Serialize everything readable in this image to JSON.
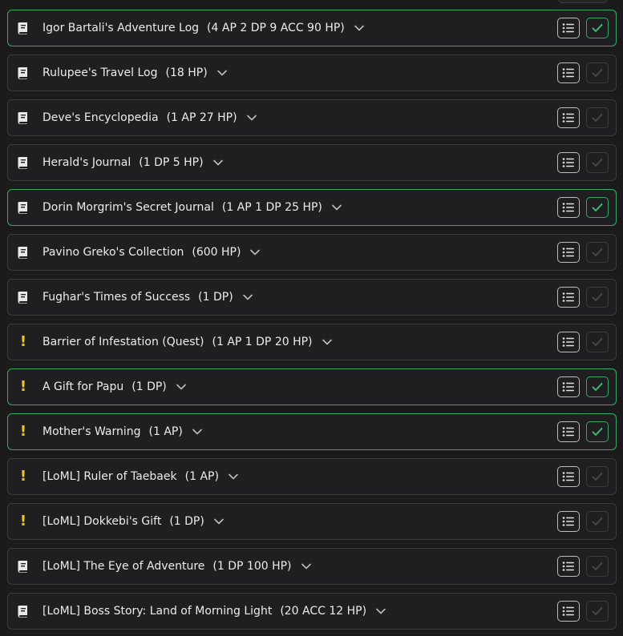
{
  "colors": {
    "background": "#1b1b1c",
    "row_background": "#1f1f21",
    "row_border": "#3a3b3d",
    "completed_accent": "#38a867",
    "quest_icon": "#f0c419",
    "text": "#ececec"
  },
  "quests": [
    {
      "title": "Igor Bartali's Adventure Log",
      "reward": "(4 AP 2 DP 9 ACC 90 HP)",
      "icon": "book-icon",
      "completed": true
    },
    {
      "title": "Rulupee's Travel Log",
      "reward": "(18 HP)",
      "icon": "book-icon",
      "completed": false
    },
    {
      "title": "Deve's Encyclopedia",
      "reward": "(1 AP 27 HP)",
      "icon": "book-icon",
      "completed": false
    },
    {
      "title": "Herald's Journal",
      "reward": "(1 DP 5 HP)",
      "icon": "book-icon",
      "completed": false
    },
    {
      "title": "Dorin Morgrim's Secret Journal",
      "reward": "(1 AP 1 DP 25 HP)",
      "icon": "book-icon",
      "completed": true
    },
    {
      "title": "Pavino Greko's Collection",
      "reward": "(600 HP)",
      "icon": "book-icon",
      "completed": false
    },
    {
      "title": "Fughar's Times of Success",
      "reward": "(1 DP)",
      "icon": "book-icon",
      "completed": false
    },
    {
      "title": "Barrier of Infestation (Quest)",
      "reward": "(1 AP 1 DP 20 HP)",
      "icon": "exclamation-icon",
      "completed": false
    },
    {
      "title": "A Gift for Papu",
      "reward": "(1 DP)",
      "icon": "exclamation-icon",
      "completed": true
    },
    {
      "title": "Mother's Warning",
      "reward": "(1 AP)",
      "icon": "exclamation-icon",
      "completed": true
    },
    {
      "title": "[LoML] Ruler of Taebaek",
      "reward": "(1 AP)",
      "icon": "exclamation-icon",
      "completed": false
    },
    {
      "title": "[LoML] Dokkebi's Gift",
      "reward": "(1 DP)",
      "icon": "exclamation-icon",
      "completed": false
    },
    {
      "title": "[LoML] The Eye of Adventure",
      "reward": "(1 DP 100 HP)",
      "icon": "book-icon",
      "completed": false
    },
    {
      "title": "[LoML] Boss Story: Land of Morning Light",
      "reward": "(20 ACC 12 HP)",
      "icon": "book-icon",
      "completed": false
    }
  ]
}
